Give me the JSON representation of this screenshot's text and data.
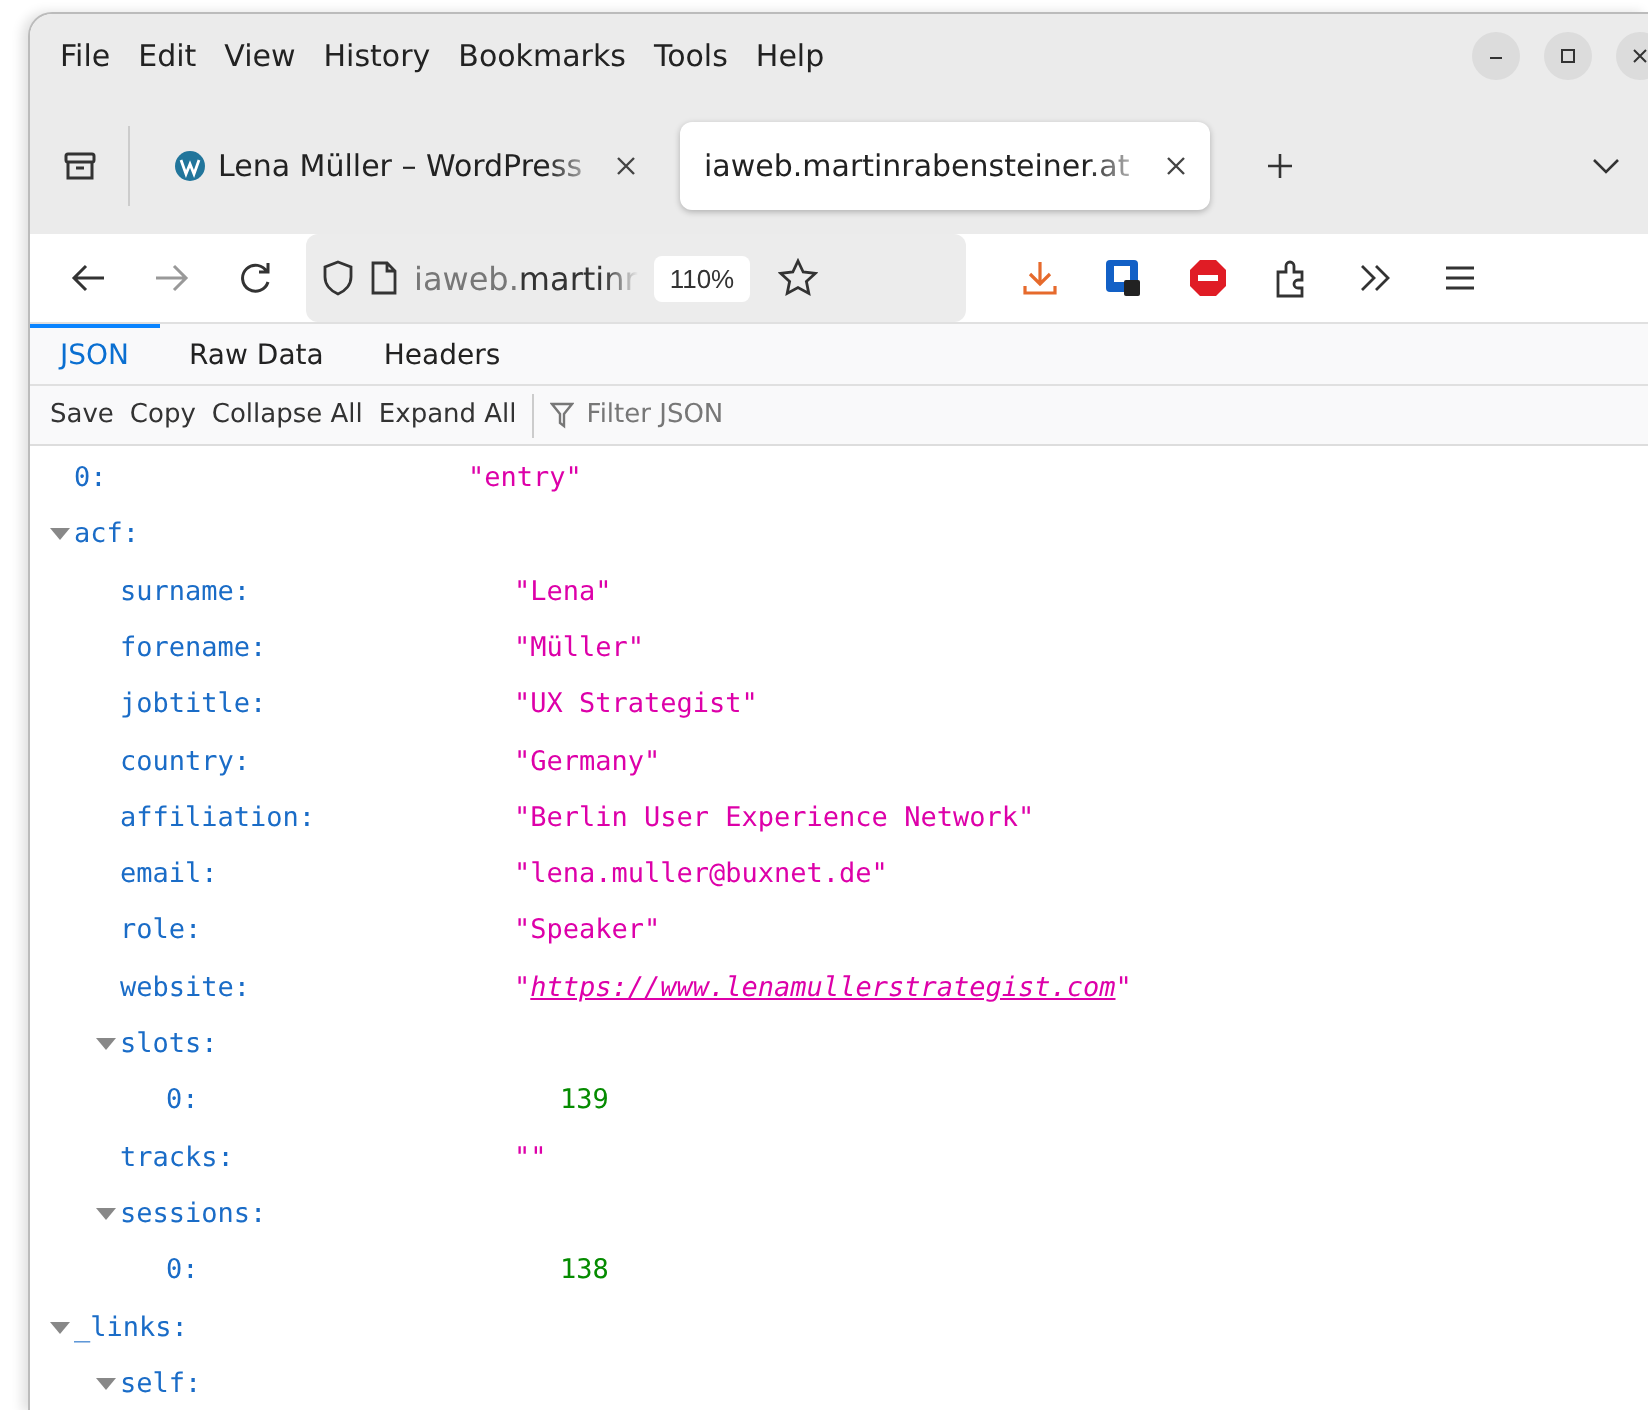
{
  "menu": [
    "File",
    "Edit",
    "View",
    "History",
    "Bookmarks",
    "Tools",
    "Help"
  ],
  "tabs": [
    {
      "title": "Lena Müller – WordPress",
      "selected": false
    },
    {
      "title": "iaweb.martinrabensteiner.at",
      "selected": true
    }
  ],
  "address_bar": {
    "url_host": "iaweb.",
    "url_rest": "martinr",
    "zoom": "110%"
  },
  "viewer_tabs": [
    {
      "label": "JSON",
      "selected": true
    },
    {
      "label": "Raw Data",
      "selected": false
    },
    {
      "label": "Headers",
      "selected": false
    }
  ],
  "viewer_toolbar": {
    "buttons": [
      "Save",
      "Copy",
      "Collapse All",
      "Expand All"
    ],
    "filter_placeholder": "Filter JSON"
  },
  "json_tree": [
    {
      "key": "0:",
      "value": "\"entry\"",
      "kind": "string"
    },
    {
      "key": "acf:",
      "expanded": true,
      "children": [
        {
          "key": "surname:",
          "value": "\"Lena\"",
          "kind": "string"
        },
        {
          "key": "forename:",
          "value": "\"Müller\"",
          "kind": "string"
        },
        {
          "key": "jobtitle:",
          "value": "\"UX Strategist\"",
          "kind": "string"
        },
        {
          "key": "country:",
          "value": "\"Germany\"",
          "kind": "string"
        },
        {
          "key": "affiliation:",
          "value": "\"Berlin User Experience Network\"",
          "kind": "string"
        },
        {
          "key": "email:",
          "value": "\"lena.muller@buxnet.de\"",
          "kind": "string"
        },
        {
          "key": "role:",
          "value": "\"Speaker\"",
          "kind": "string"
        },
        {
          "key": "website:",
          "value": "\"https://www.lenamullerstrategist.com\"",
          "kind": "link"
        },
        {
          "key": "slots:",
          "expanded": true,
          "children": [
            {
              "key": "0:",
              "value": "139",
              "kind": "number"
            }
          ]
        },
        {
          "key": "tracks:",
          "value": "\"\"",
          "kind": "string"
        },
        {
          "key": "sessions:",
          "expanded": true,
          "children": [
            {
              "key": "0:",
              "value": "138",
              "kind": "number"
            }
          ]
        }
      ]
    },
    {
      "key": "_links:",
      "expanded": true,
      "children": [
        {
          "key": "self:",
          "expanded": true
        }
      ]
    }
  ]
}
